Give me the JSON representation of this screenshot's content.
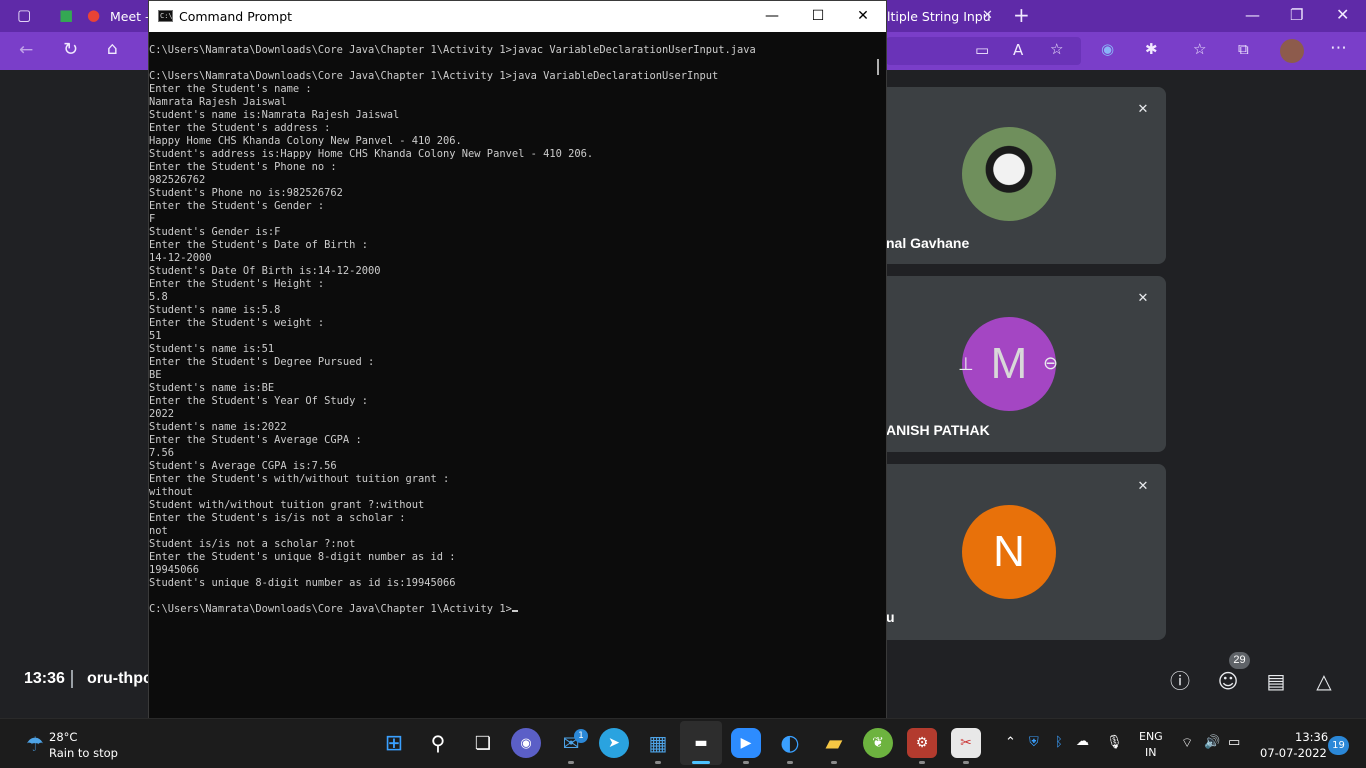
{
  "browser": {
    "meet_tab_title": "Meet –",
    "other_tab_title": "ltiple String Inpu",
    "close_tab_symbol": "✕",
    "new_tab_symbol": "+"
  },
  "cmd": {
    "title": "Command Prompt",
    "icon_text": "C:\\",
    "lines": [
      "C:\\Users\\Namrata\\Downloads\\Core Java\\Chapter 1\\Activity 1>javac VariableDeclarationUserInput.java",
      "",
      "C:\\Users\\Namrata\\Downloads\\Core Java\\Chapter 1\\Activity 1>java VariableDeclarationUserInput",
      "Enter the Student's name :",
      "Namrata Rajesh Jaiswal",
      "Student's name is:Namrata Rajesh Jaiswal",
      "Enter the Student's address :",
      "Happy Home CHS Khanda Colony New Panvel - 410 206.",
      "Student's address is:Happy Home CHS Khanda Colony New Panvel - 410 206.",
      "Enter the Student's Phone no :",
      "982526762",
      "Student's Phone no is:982526762",
      "Enter the Student's Gender :",
      "F",
      "Student's Gender is:F",
      "Enter the Student's Date of Birth :",
      "14-12-2000",
      "Student's Date Of Birth is:14-12-2000",
      "Enter the Student's Height :",
      "5.8",
      "Student's name is:5.8",
      "Enter the Student's weight :",
      "51",
      "Student's name is:51",
      "Enter the Student's Degree Pursued :",
      "BE",
      "Student's name is:BE",
      "Enter the Student's Year Of Study :",
      "2022",
      "Student's name is:2022",
      "Enter the Student's Average CGPA :",
      "7.56",
      "Student's Average CGPA is:7.56",
      "Enter the Student's with/without tuition grant :",
      "without",
      "Student with/without tuition grant ?:without",
      "Enter the Student's is/is not a scholar :",
      "not",
      "Student is/is not a scholar ?:not",
      "Enter the Student's unique 8-digit number as id :",
      "19945066",
      "Student's unique 8-digit number as id is:19945066",
      "",
      "C:\\Users\\Namrata\\Downloads\\Core Java\\Chapter 1\\Activity 1>"
    ]
  },
  "meet": {
    "time": "13:36",
    "code": "oru-thpc",
    "participants": [
      {
        "name": "nal Gavhane",
        "avatar_letter": ""
      },
      {
        "name": "ANISH PATHAK",
        "avatar_letter": "M"
      },
      {
        "name": "u",
        "avatar_letter": "N"
      }
    ],
    "people_count": "29"
  },
  "taskbar": {
    "weather_temp": "28°C",
    "weather_condition": "Rain to stop",
    "mail_badge": "1",
    "lang_line1": "ENG",
    "lang_line2": "IN",
    "clock_time": "13:36",
    "clock_date": "07-07-2022",
    "notification_count": "19"
  },
  "colors": {
    "browser_purple": "#7a3ec9",
    "avatar_m": "#a446c3",
    "avatar_n": "#e8710a",
    "tile_bg": "#3c4043"
  }
}
